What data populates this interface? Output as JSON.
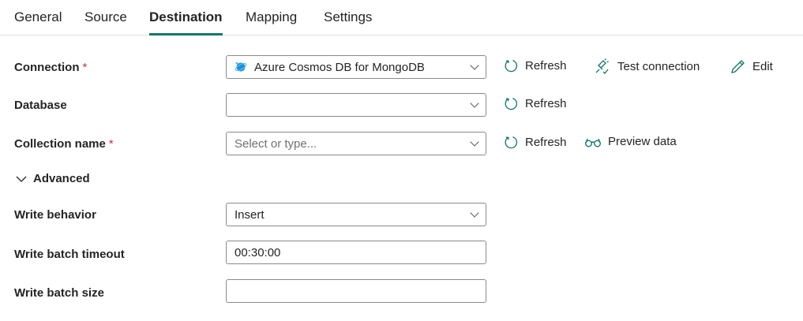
{
  "tabs": [
    "General",
    "Source",
    "Destination",
    "Mapping",
    "Settings"
  ],
  "active_tab": "Destination",
  "connection": {
    "label": "Connection",
    "required": "*",
    "value": "Azure Cosmos DB for MongoDB",
    "refresh": "Refresh",
    "test": "Test connection",
    "edit": "Edit"
  },
  "database": {
    "label": "Database",
    "value": "",
    "refresh": "Refresh"
  },
  "collection": {
    "label": "Collection name",
    "required": "*",
    "placeholder": "Select or type...",
    "refresh": "Refresh",
    "preview": "Preview data"
  },
  "advanced": {
    "label": "Advanced"
  },
  "write_behavior": {
    "label": "Write behavior",
    "value": "Insert"
  },
  "write_batch_timeout": {
    "label": "Write batch timeout",
    "value": "00:30:00"
  },
  "write_batch_size": {
    "label": "Write batch size",
    "value": ""
  },
  "colors": {
    "accent": "#117865",
    "required": "#c4314b"
  }
}
